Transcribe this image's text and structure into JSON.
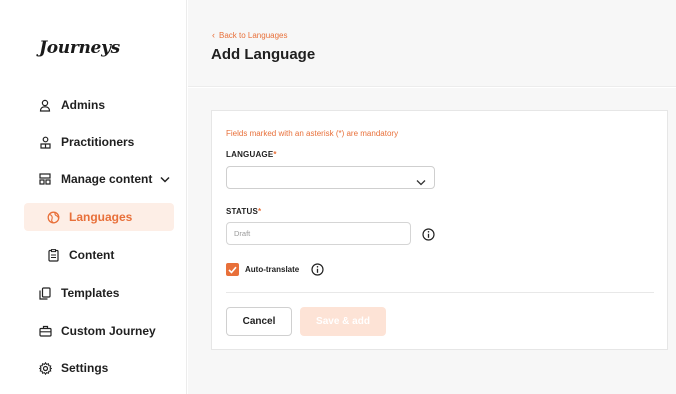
{
  "brand": {
    "logo_text": "Journeys",
    "accent_color": "#e8703a"
  },
  "sidebar": {
    "items": [
      {
        "label": "Admins",
        "icon": "user-icon"
      },
      {
        "label": "Practitioners",
        "icon": "users-icon"
      },
      {
        "label": "Manage content",
        "icon": "content-grid-icon",
        "expanded": true
      },
      {
        "label": "Languages",
        "icon": "globe-icon",
        "active": true
      },
      {
        "label": "Content",
        "icon": "document-icon"
      },
      {
        "label": "Templates",
        "icon": "templates-icon"
      },
      {
        "label": "Custom Journey",
        "icon": "briefcase-icon"
      },
      {
        "label": "Settings",
        "icon": "gear-icon"
      }
    ]
  },
  "header": {
    "back_link": "Back to Languages",
    "title": "Add Language"
  },
  "form": {
    "mandatory_note": "Fields marked with an asterisk (*) are mandatory",
    "language": {
      "label": "LANGUAGE",
      "required_mark": "*",
      "value": ""
    },
    "status": {
      "label": "STATUS",
      "required_mark": "*",
      "value": "Draft"
    },
    "auto_translate": {
      "label": "Auto-translate",
      "checked": true
    },
    "cancel_label": "Cancel",
    "save_label": "Save & add"
  }
}
